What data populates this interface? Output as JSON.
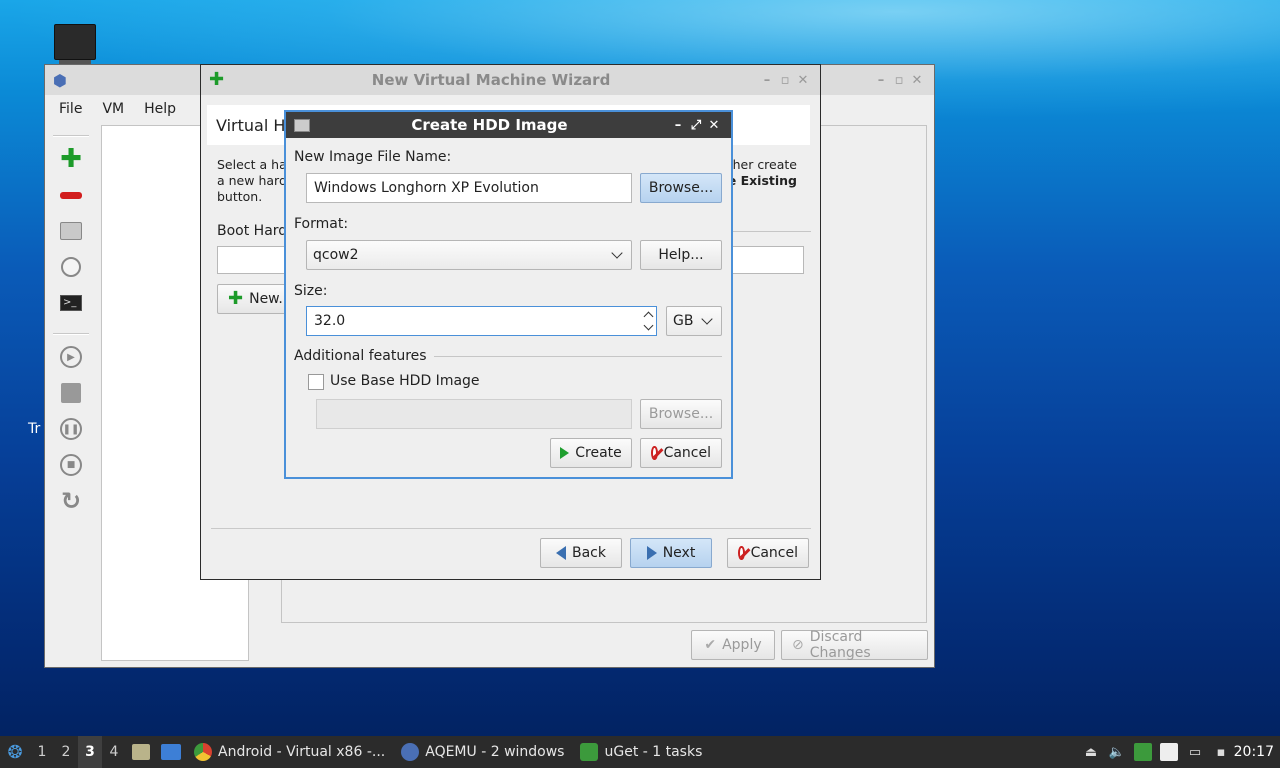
{
  "desktop": {
    "partial_label": "Tr"
  },
  "aqemu": {
    "title": "",
    "menu": [
      "File",
      "VM",
      "Help"
    ],
    "apply_label": "Apply",
    "discard_label": "Discard Changes"
  },
  "wizard": {
    "title": "New Virtual Machine Wizard",
    "header": "Virtual Ha",
    "desc_line1_left": "Select a har",
    "desc_line1_right": "ther create",
    "desc_line2_left": "a new hard",
    "desc_line2_right": "e Existing",
    "desc_line3": "button.",
    "boot_label": "Boot Hard",
    "new_label": "New..",
    "back_label": "Back",
    "next_label": "Next",
    "cancel_label": "Cancel"
  },
  "hdd_dialog": {
    "title": "Create HDD Image",
    "file_name_label": "New Image File Name:",
    "file_name_value": "Windows Longhorn XP Evolution",
    "browse_label": "Browse...",
    "format_label": "Format:",
    "format_value": "qcow2",
    "help_label": "Help...",
    "size_label": "Size:",
    "size_value": "32.0",
    "size_unit": "GB",
    "additional_features_label": "Additional features",
    "use_base_label": "Use Base HDD Image",
    "use_base_checked": false,
    "base_browse_label": "Browse...",
    "create_label": "Create",
    "cancel_label": "Cancel"
  },
  "taskbar": {
    "workspaces": [
      "1",
      "2",
      "3",
      "4"
    ],
    "active_workspace": "3",
    "tasks": [
      {
        "label": "Android - Virtual x86 -...",
        "icon": "chrome-icon",
        "color": "#d9412f"
      },
      {
        "label": "AQEMU - 2 windows",
        "icon": "aqemu-icon",
        "color": "#4a6fb5"
      },
      {
        "label": "uGet - 1 tasks",
        "icon": "uget-icon",
        "color": "#3c9a3c"
      }
    ],
    "clock": "20:17"
  },
  "colors": {
    "accent": "#4a90d9",
    "taskbar_bg": "#2b2b2b",
    "dialog_title_bg": "#3d3d3d"
  }
}
